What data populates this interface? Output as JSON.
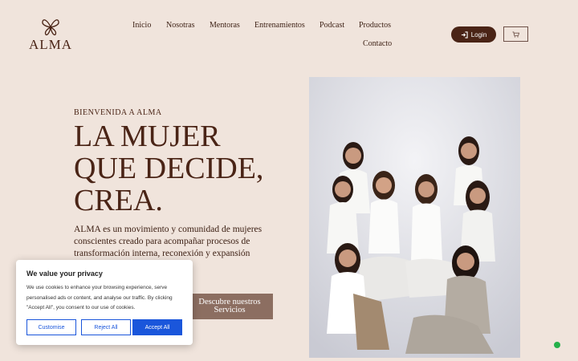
{
  "brand": {
    "name": "ALMA",
    "logo_icon": "butterfly-icon"
  },
  "nav": {
    "items": [
      {
        "label": "Inicio"
      },
      {
        "label": "Nosotras"
      },
      {
        "label": "Mentoras"
      },
      {
        "label": "Entrenamientos"
      },
      {
        "label": "Podcast"
      },
      {
        "label": "Productos"
      },
      {
        "label": "Contacto"
      }
    ],
    "login_label": "Login",
    "login_icon": "login-arrow-icon",
    "cart_icon": "cart-icon"
  },
  "hero": {
    "welcome": "BIENVENIDA A ALMA",
    "headline_lines": [
      "LA MUJER",
      "QUE DECIDE,",
      "CREA."
    ],
    "description": "ALMA es un movimiento y comunidad de mujeres conscientes creado para acompañar procesos de transformación interna, reconexión y expansión",
    "cta_lines": [
      "Descubre nuestros",
      "Servicios"
    ],
    "photo": "group-of-women-photo"
  },
  "cookie": {
    "title": "We value your privacy",
    "text": "We use cookies to enhance your browsing experience, serve personalised ads or content, and analyse our traffic. By clicking \"Accept All\", you consent to our use of cookies.",
    "customise_label": "Customise",
    "reject_label": "Reject All",
    "accept_label": "Accept All"
  },
  "colors": {
    "background": "#f0e4dc",
    "brand_brown": "#4a2416",
    "cta": "#8c6e61",
    "cookie_accent": "#1a56db",
    "chat": "#25b04a"
  }
}
